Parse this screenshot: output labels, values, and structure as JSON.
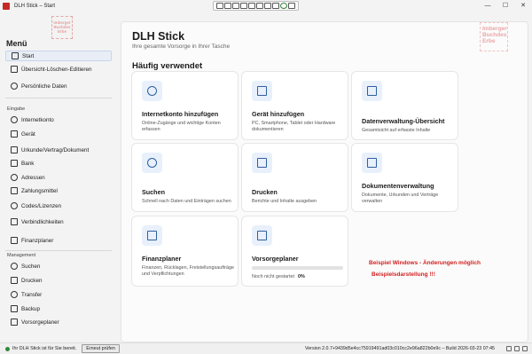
{
  "window": {
    "title": "DLH Stick – Start",
    "controls": [
      "—",
      "☐",
      "✕"
    ]
  },
  "logo": {
    "lines": [
      "Imberger",
      "Buchdes",
      "Erbe"
    ]
  },
  "sidebar": {
    "menu_title": "Menü",
    "top_items": [
      {
        "label": "Start",
        "icon": "home-icon",
        "active": true
      },
      {
        "label": "Übersicht-Löschen-Editieren",
        "icon": "list-icon"
      },
      {
        "label": "Persönliche Daten",
        "icon": "person-icon"
      }
    ],
    "sections": [
      {
        "title": "Eingabe",
        "items": [
          {
            "label": "Internetkonto",
            "icon": "globe-icon"
          },
          {
            "label": "Gerät",
            "icon": "laptop-icon"
          },
          {
            "label": "Urkunde/Vertrag/Dokument",
            "icon": "document-icon"
          },
          {
            "label": "Bank",
            "icon": "bank-icon"
          },
          {
            "label": "Adressen",
            "icon": "location-icon"
          },
          {
            "label": "Zahlungsmittel",
            "icon": "card-icon"
          },
          {
            "label": "Codes/Lizenzen",
            "icon": "key-icon"
          },
          {
            "label": "Verbindlichkeiten",
            "icon": "link-icon"
          },
          {
            "label": "Finanzplaner",
            "icon": "chart-icon"
          }
        ]
      },
      {
        "title": "Management",
        "items": [
          {
            "label": "Suchen",
            "icon": "search-icon"
          },
          {
            "label": "Drucken",
            "icon": "printer-icon"
          },
          {
            "label": "Transfer",
            "icon": "transfer-icon"
          },
          {
            "label": "Backup",
            "icon": "backup-icon"
          },
          {
            "label": "Vorsorgeplaner",
            "icon": "planner-icon"
          }
        ]
      }
    ]
  },
  "main": {
    "title": "DLH Stick",
    "subtitle": "Ihre gesamte Vorsorge in Ihrer Tasche",
    "section_title": "Häufig verwendet",
    "cards": [
      {
        "title": "Internetkonto hinzufügen",
        "desc": "Online-Zugänge und wichtige Konten erfassen",
        "icon": "globe-icon"
      },
      {
        "title": "Gerät hinzufügen",
        "desc": "PC, Smartphone, Tablet oder Hardware dokumentieren",
        "icon": "laptop-icon"
      },
      {
        "title": "Datenverwaltung-Übersicht",
        "desc": "Gesamtsicht auf erfasste Inhalte",
        "icon": "book-icon"
      },
      {
        "title": "Suchen",
        "desc": "Schnell nach Daten und Einträgen suchen",
        "icon": "search-icon"
      },
      {
        "title": "Drucken",
        "desc": "Berichte und Inhalte ausgeben",
        "icon": "printer-icon"
      },
      {
        "title": "Dokumentenverwaltung",
        "desc": "Dokumente, Urkunden und Verträge verwalten",
        "icon": "document-icon"
      },
      {
        "title": "Finanzplaner",
        "desc": "Finanzen, Rücklagen, Freistellungsaufträge und Verpflichtungen",
        "icon": "chart-icon"
      }
    ],
    "planner": {
      "title": "Vorsorgeplaner",
      "status": "Noch nicht gestartet",
      "progress_label": "0%",
      "progress": 0,
      "icon": "planner-icon"
    },
    "demo_note": {
      "line1": "Beispiel Windows - Änderungen möglich",
      "line2": "Beispielsdarstellung !!!",
      "color": "#d32020"
    }
  },
  "statusbar": {
    "status_text": "Ihr DLH Stick ist für Sie bereit.",
    "check_button": "Erneut prüfen",
    "version": "Version 2.0.7+9439d5e4cc75919491ad03c010cc2e96a822b0e9c – Build 2026-03-23 07:45"
  }
}
